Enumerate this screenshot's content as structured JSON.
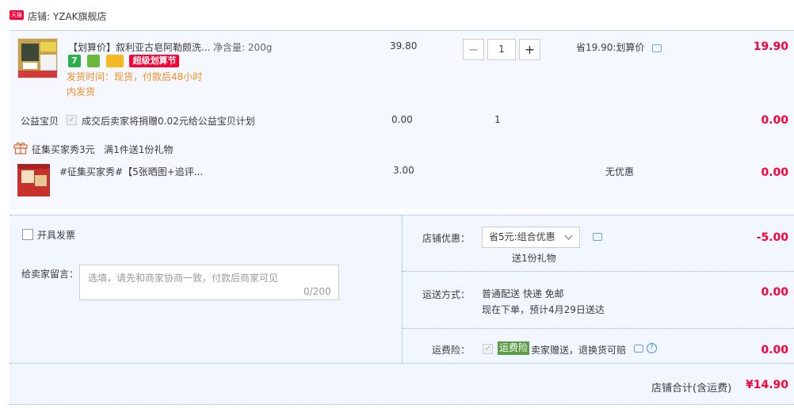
{
  "shop": {
    "badge": "天猫",
    "label": "店铺: YZAK旗舰店"
  },
  "item": {
    "title": "【划算价】叙利亚古皂阿勒颇洗...",
    "spec": "净含量: 200g",
    "unit_price": "39.80",
    "badge_super": "超级划算节",
    "ship_time_1": "发货时间：现货，付款后48小时",
    "ship_time_2": "内发货",
    "quantity": "1",
    "promo": "省19.90:划算价",
    "total": "19.90",
    "icons": [
      "seven-day-return-icon",
      "tmall-guarantee-icon",
      "credit-card-icon"
    ]
  },
  "charity": {
    "label": "公益宝贝",
    "text": "成交后卖家将捐赠0.02元给公益宝贝计划",
    "price": "0.00",
    "qty": "1",
    "total": "0.00"
  },
  "gift": {
    "header": "征集买家秀3元   满1件送1份礼物",
    "title": "#征集买家秀#【5张晒图+追评...",
    "price": "3.00",
    "promo": "无优惠",
    "total": "0.00"
  },
  "invoice": {
    "label": "开具发票"
  },
  "memo": {
    "label": "给卖家留言：",
    "placeholder": "选填，请先和商家协商一致，付款后商家可见",
    "count": "0/200"
  },
  "discount": {
    "label": "店铺优惠：",
    "selected": "省5元:组合优惠",
    "gift": "送1份礼物",
    "amount": "-5.00"
  },
  "shipping": {
    "label": "运送方式：",
    "line1": "普通配送 快递 免邮",
    "line2": "现在下单，预计4月29日送达",
    "amount": "0.00"
  },
  "insurance": {
    "label": "运费险：",
    "badge": "运费险",
    "text": "卖家赠送，退换货可赔",
    "amount": "0.00"
  },
  "summary": {
    "label": "店铺合计(含运费)",
    "amount": "¥14.90"
  },
  "colors": {
    "accent_red": "#ff0036",
    "orange": "#f68e22",
    "blue_border": "#b2d1ff",
    "green": "#5c9c46"
  }
}
